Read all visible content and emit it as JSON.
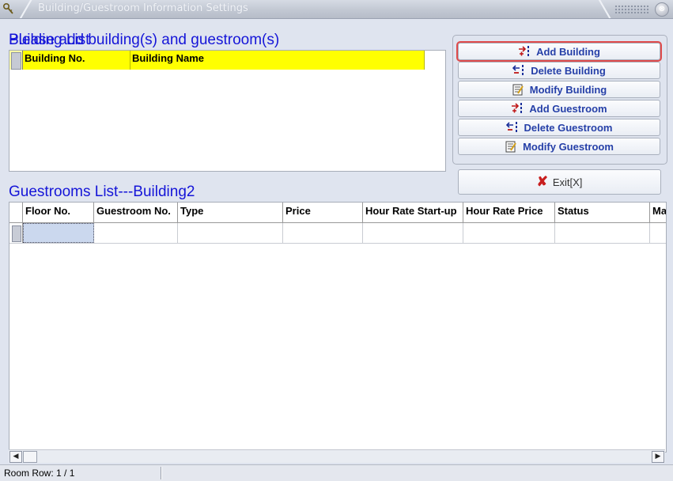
{
  "window": {
    "title": "Building/Guestroom Information Settings",
    "close_glyph": "⊗",
    "icons": {
      "app": "key-icon",
      "close": "close-icon"
    }
  },
  "building_section": {
    "heading": "Please add building(s) and guestroom(s)",
    "heading_overlay": "Building List",
    "columns": [
      "Building No.",
      "Building Name"
    ],
    "header_color": "#ffff00"
  },
  "actions": {
    "buttons": [
      {
        "label": "Add Building",
        "icon": "add-icon"
      },
      {
        "label": "Delete Building",
        "icon": "delete-icon"
      },
      {
        "label": "Modify Building",
        "icon": "modify-icon"
      },
      {
        "label": "Add Guestroom",
        "icon": "add-icon"
      },
      {
        "label": "Delete Guestroom",
        "icon": "delete-icon"
      },
      {
        "label": "Modify Guestroom",
        "icon": "modify-icon"
      }
    ],
    "exit": {
      "label": "Exit[X]",
      "icon": "exit-x-icon",
      "glyph": "✘"
    },
    "highlight_color": "#e04b4b"
  },
  "guestroom_section": {
    "heading": "Guestrooms List---Building2",
    "columns": [
      "Floor No.",
      "Guestroom No.",
      "Type",
      "Price",
      "Hour Rate Start-up",
      "Hour Rate Price",
      "Status",
      "Ma"
    ]
  },
  "scrollbar": {
    "left_arrow": "◀",
    "right_arrow": "▶"
  },
  "status": {
    "room_row": "Room Row: 1 / 1"
  },
  "colors": {
    "heading": "#1515d8",
    "button_text": "#2640a8",
    "background": "#dfe4ef"
  }
}
